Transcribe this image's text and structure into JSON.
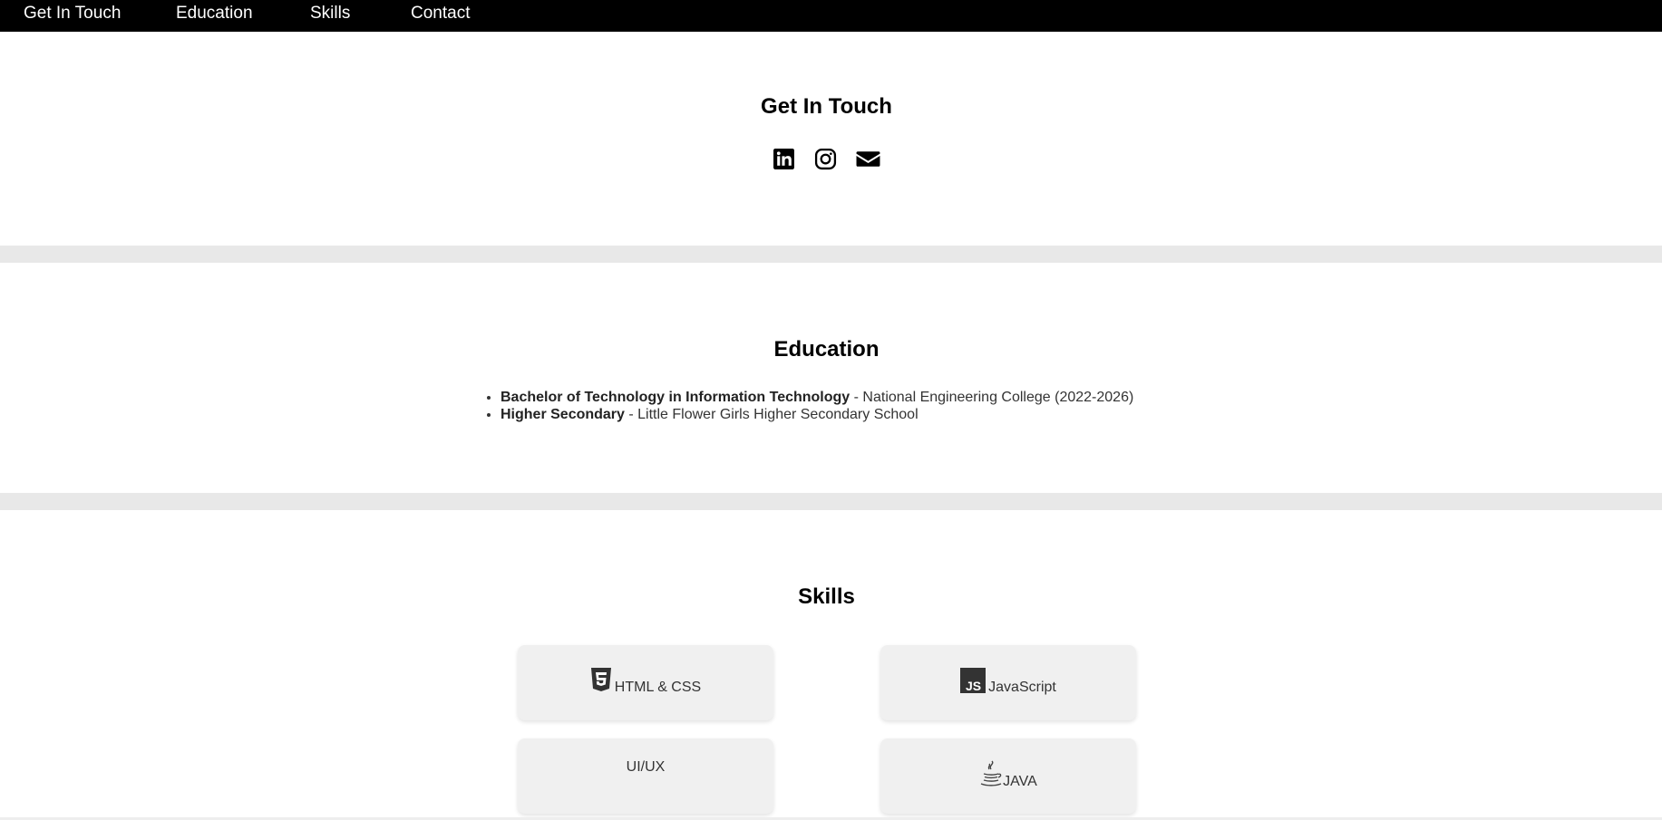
{
  "nav": {
    "items": [
      {
        "label": "Get In Touch"
      },
      {
        "label": "Education"
      },
      {
        "label": "Skills"
      },
      {
        "label": "Contact"
      }
    ]
  },
  "contact": {
    "title": "Get In Touch",
    "icons": [
      "linkedin-icon",
      "instagram-icon",
      "email-icon"
    ]
  },
  "education": {
    "title": "Education",
    "items": [
      {
        "degree": "Bachelor of Technology in Information Technology",
        "detail": " - National Engineering College (2022-2026)"
      },
      {
        "degree": "Higher Secondary",
        "detail": " - Little Flower Girls Higher Secondary School"
      }
    ]
  },
  "skills": {
    "title": "Skills",
    "items": [
      {
        "label": "HTML & CSS",
        "icon": "html5-icon"
      },
      {
        "label": "JavaScript",
        "icon": "javascript-icon"
      },
      {
        "label": "UI/UX",
        "icon": ""
      },
      {
        "label": "JAVA",
        "icon": "java-icon"
      }
    ]
  },
  "colors": {
    "nav_bg": "#000000",
    "nav_text": "#ffffff",
    "divider": "#e8e8e8",
    "card_bg": "#f0f0f0"
  }
}
